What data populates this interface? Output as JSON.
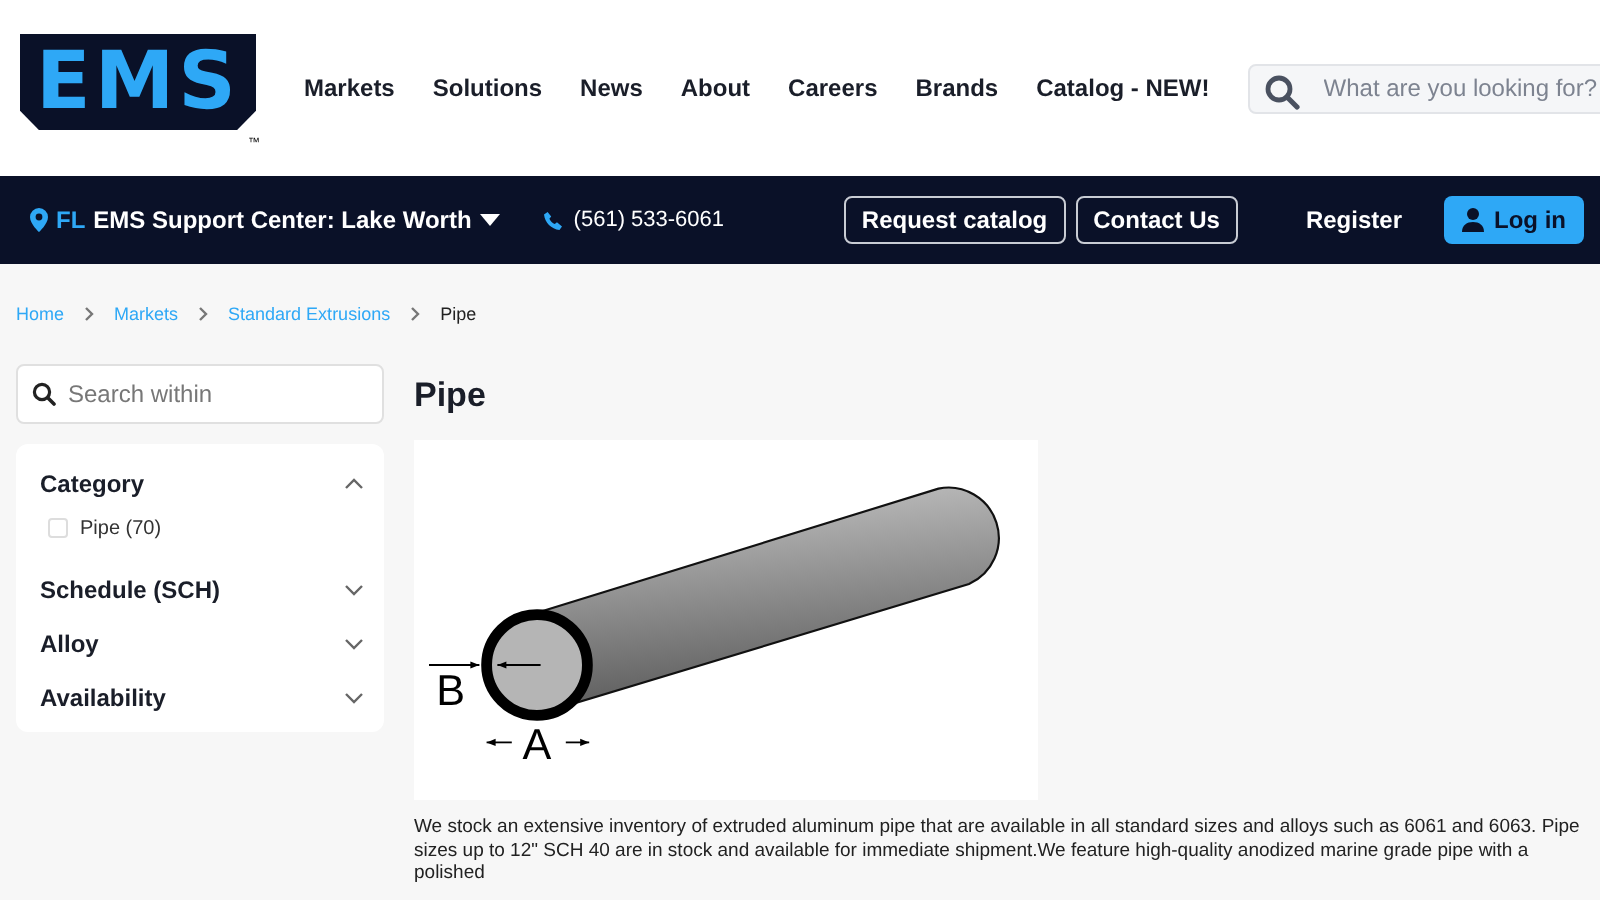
{
  "header": {
    "logo": {
      "text": "EMS",
      "mark": "™"
    },
    "nav": [
      "Markets",
      "Solutions",
      "News",
      "About",
      "Careers",
      "Brands",
      "Catalog - NEW!"
    ],
    "search": {
      "placeholder": "What are you looking for?"
    }
  },
  "topbar": {
    "state": "FL",
    "location": "EMS Support Center: Lake Worth",
    "phone": "(561) 533-6061",
    "buttons": [
      {
        "label": "Request catalog",
        "kind": "outline"
      },
      {
        "label": "Contact Us",
        "kind": "outline"
      },
      {
        "label": "Register",
        "kind": "link"
      },
      {
        "label": "Log in",
        "kind": "primary"
      }
    ]
  },
  "breadcrumb": [
    {
      "label": "Home",
      "current": false
    },
    {
      "label": "Markets",
      "current": false
    },
    {
      "label": "Standard Extrusions",
      "current": false
    },
    {
      "label": "Pipe",
      "current": true
    }
  ],
  "sidebar": {
    "search": {
      "placeholder": "Search within"
    },
    "filters": [
      {
        "title": "Category",
        "expanded": true,
        "options": [
          {
            "label": "Pipe (70)",
            "checked": false
          }
        ]
      },
      {
        "title": "Schedule (SCH)",
        "expanded": false
      },
      {
        "title": "Alloy",
        "expanded": false
      },
      {
        "title": "Availability",
        "expanded": false
      }
    ]
  },
  "main": {
    "title": "Pipe",
    "diagram_labels": [
      "A",
      "B"
    ],
    "description": "We stock an extensive inventory of extruded aluminum pipe that are available in all standard sizes and alloys such as 6061 and 6063. Pipe sizes up to 12\" SCH 40 are in stock and available for immediate shipment.We feature high-quality anodized marine grade pipe with a polished"
  }
}
